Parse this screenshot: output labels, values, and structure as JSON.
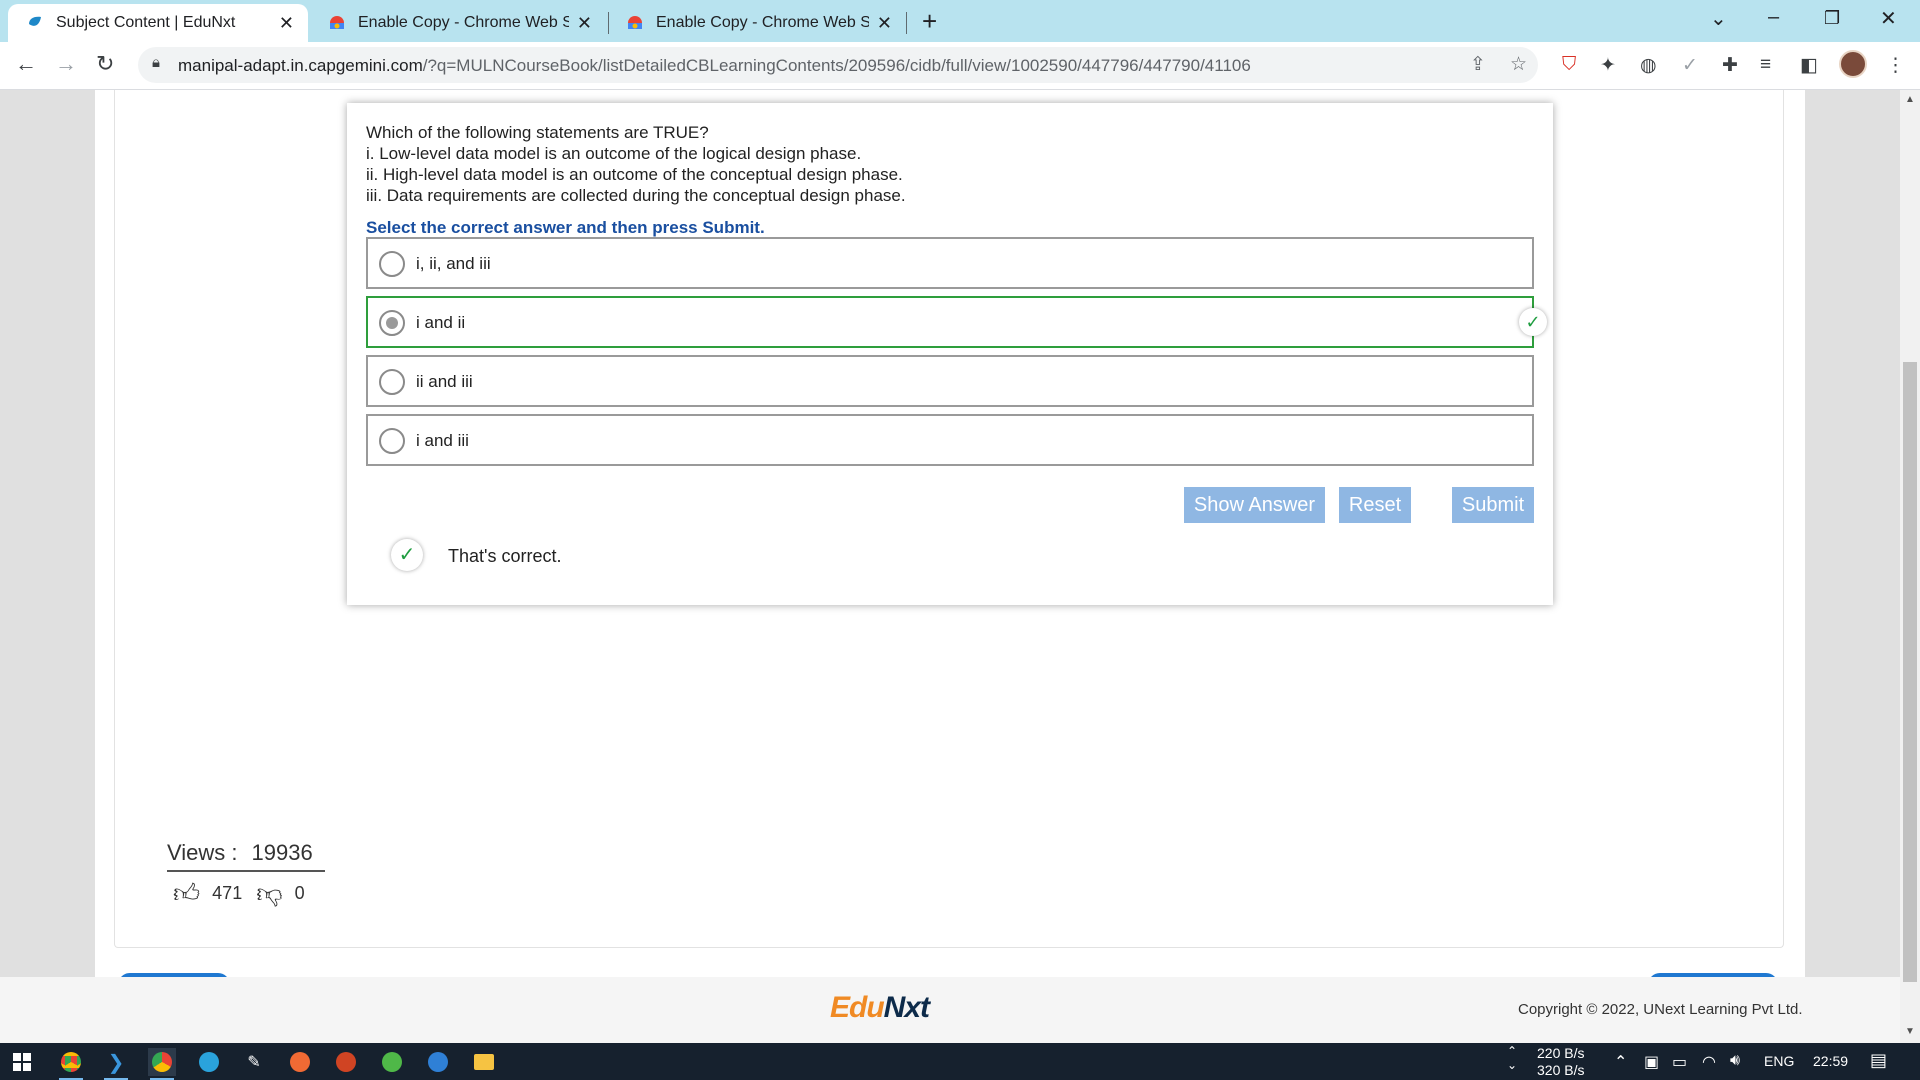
{
  "browser": {
    "tabs": [
      {
        "title": "Subject Content | EduNxt",
        "active": true
      },
      {
        "title": "Enable Copy - Chrome Web Store",
        "active": false
      },
      {
        "title": "Enable Copy - Chrome Web Store",
        "active": false
      }
    ],
    "url_host": "manipal-adapt.in.capgemini.com",
    "url_path": "/?q=MULNCourseBook/listDetailedCBLearningContents/209596/cidb/full/view/1002590/447796/447790/41106"
  },
  "quiz": {
    "question_lines": [
      "Which of the following statements are TRUE?",
      "i. Low-level data model is an outcome of the logical design phase.",
      "ii. High-level data model is an outcome of the conceptual design phase.",
      "iii. Data requirements are collected during the conceptual design phase."
    ],
    "instruction": "Select the correct answer and then press Submit.",
    "options": [
      {
        "label": "i, ii, and iii",
        "selected": false,
        "correct": false
      },
      {
        "label": "i and ii",
        "selected": true,
        "correct": true
      },
      {
        "label": "ii and iii",
        "selected": false,
        "correct": false
      },
      {
        "label": "i and iii",
        "selected": false,
        "correct": false
      }
    ],
    "buttons": {
      "show_answer": "Show Answer",
      "reset": "Reset",
      "submit": "Submit"
    },
    "feedback": "That's correct."
  },
  "stats": {
    "views_label": "Views :",
    "views_count": "19936",
    "likes": "471",
    "dislikes": "0"
  },
  "footer": {
    "logo_part1": "Edu",
    "logo_part2": "Nxt",
    "copyright": "Copyright © 2022, UNext Learning Pvt Ltd."
  },
  "taskbar": {
    "net_up": "220 B/s",
    "net_down": "320 B/s",
    "language": "ENG",
    "time": "22:59"
  },
  "colors": {
    "tabstrip": "#b8e3ef",
    "instruction": "#1a4fa0",
    "correct": "#2e9e3c",
    "button": "#8fb7e3",
    "taskbar": "#16212e"
  }
}
